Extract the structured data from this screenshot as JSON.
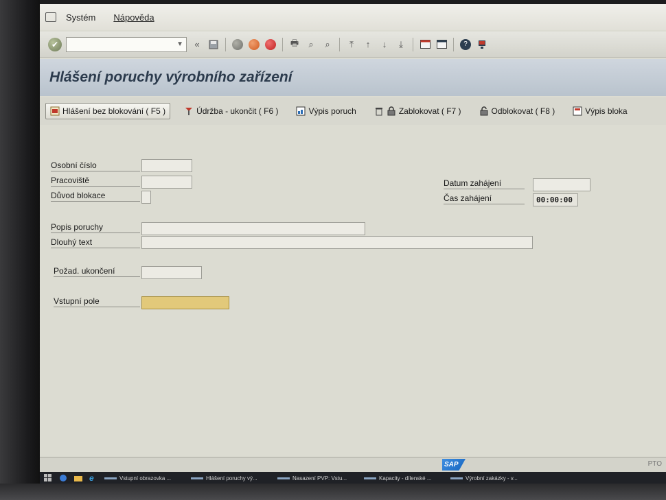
{
  "menu": {
    "items": [
      "Systém",
      "Nápověda"
    ]
  },
  "toolbar": {
    "command_field_value": "",
    "icons": [
      "ok-icon",
      "back-double-icon",
      "save-icon",
      "back-icon",
      "exit-icon",
      "cancel-icon",
      "print-icon",
      "find-icon",
      "find-next-icon",
      "first-page-icon",
      "prev-page-icon",
      "next-page-icon",
      "last-page-icon",
      "new-session-icon",
      "shortcut-icon",
      "help-icon",
      "customize-icon"
    ]
  },
  "title": "Hlášení poruchy výrobního zařízení",
  "app_toolbar": {
    "btn_report": "Hlášení bez blokování ( F5 )",
    "btn_maint": "Údržba - ukončit ( F6 )",
    "btn_list": "Výpis poruch",
    "btn_lock": "Zablokovat ( F7 )",
    "btn_unlock": "Odblokovat ( F8 )",
    "btn_list_lock": "Výpis bloka"
  },
  "form": {
    "personal_no": {
      "label": "Osobní číslo",
      "value": ""
    },
    "workplace": {
      "label": "Pracoviště",
      "value": ""
    },
    "block_reason": {
      "label": "Důvod blokace",
      "value": ""
    },
    "start_date": {
      "label": "Datum zahájení",
      "value": ""
    },
    "start_time": {
      "label": "Čas zahájení",
      "value": "00:00:00"
    },
    "fault_desc": {
      "label": "Popis poruchy",
      "value": ""
    },
    "long_text": {
      "label": "Dlouhý text",
      "value": ""
    },
    "req_end": {
      "label": "Požad. ukončení",
      "value": ""
    },
    "input_field": {
      "label": "Vstupní pole",
      "value": ""
    }
  },
  "status": {
    "right_text": "PTO"
  },
  "taskbar": {
    "items": [
      "Vstupní obrazovka ...",
      "Hlášení poruchy vý...",
      "Nasazení PVP: Vstu...",
      "Kapacity - dílenské ...",
      "Výrobní zakázky - v..."
    ]
  },
  "colors": {
    "title_text": "#2c3b4d",
    "active_field": "#e2c97a",
    "sap_blue": "#1565c0"
  }
}
